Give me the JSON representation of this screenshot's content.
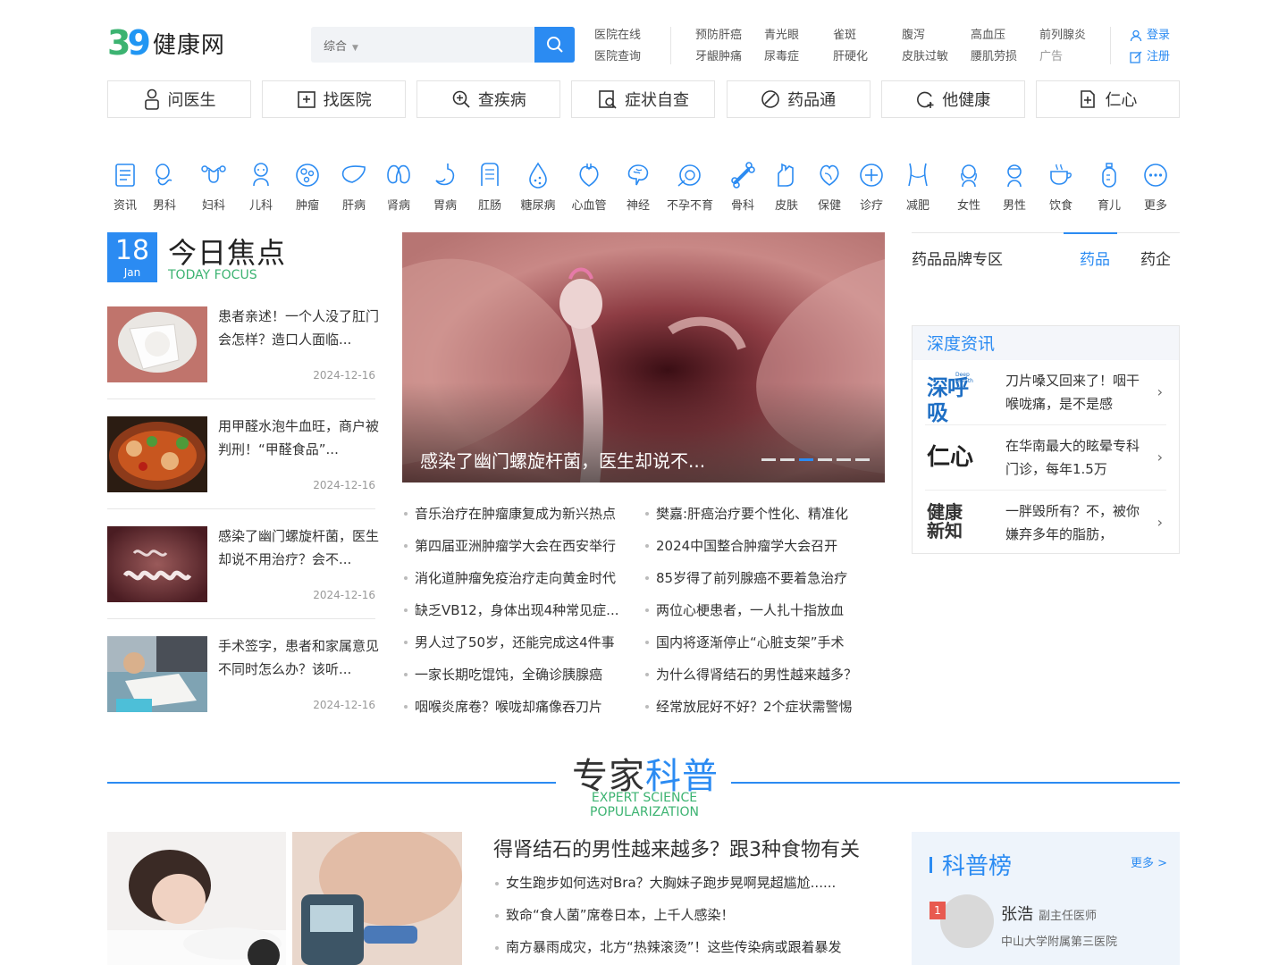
{
  "logo": {
    "digit_3": "3",
    "digit_9": "9",
    "text": "39健康网"
  },
  "search": {
    "category": "综合",
    "placeholder": ""
  },
  "toplinks": [
    [
      "医院在线",
      "医院查询"
    ],
    [
      "预防肝癌",
      "牙龈肿痛"
    ],
    [
      "青光眼",
      "尿毒症"
    ],
    [
      "雀斑",
      "肝硬化"
    ],
    [
      "腹泻",
      "皮肤过敏"
    ],
    [
      "高血压",
      "腰肌劳损"
    ],
    [
      "前列腺炎",
      "广告"
    ]
  ],
  "user": {
    "login": "登录",
    "register": "注册"
  },
  "mainnav": [
    "问医生",
    "找医院",
    "查疾病",
    "症状自查",
    "药品通",
    "他健康",
    "仁心"
  ],
  "categories": [
    "资讯",
    "男科",
    "妇科",
    "儿科",
    "肿瘤",
    "肝病",
    "肾病",
    "胃病",
    "肛肠",
    "糖尿病",
    "心血管",
    "神经",
    "不孕不育",
    "骨科",
    "皮肤",
    "保健",
    "诊疗",
    "减肥",
    "女性",
    "男性",
    "饮食",
    "育儿",
    "更多"
  ],
  "focus": {
    "day": "18",
    "month": "Jan",
    "title": "今日焦点",
    "subtitle": "TODAY FOCUS",
    "items": [
      {
        "title": "患者亲述！一个人没了肛门会怎样？造口人面临...",
        "date": "2024-12-16"
      },
      {
        "title": "用甲醛水泡牛血旺，商户被判刑！“甲醛食品”...",
        "date": "2024-12-16"
      },
      {
        "title": "感染了幽门螺旋杆菌，医生却说不用治疗？会不...",
        "date": "2024-12-16"
      },
      {
        "title": "手术签字，患者和家属意见不同时怎么办？该听...",
        "date": "2024-12-16"
      }
    ]
  },
  "carousel": {
    "caption": "感染了幽门螺旋杆菌，医生却说不...",
    "active_dot": 3,
    "dot_count": 6
  },
  "news": [
    [
      "音乐治疗在肿瘤康复成为新兴热点",
      "樊嘉:肝癌治疗要个性化、精准化"
    ],
    [
      "第四届亚洲肿瘤学大会在西安举行",
      "2024中国整合肿瘤学大会召开"
    ],
    [
      "消化道肿瘤免疫治疗走向黄金时代",
      "85岁得了前列腺癌不要着急治疗"
    ],
    [
      "缺乏VB12，身体出现4种常见症...",
      "两位心梗患者，一人扎十指放血"
    ],
    [
      "男人过了50岁，还能完成这4件事",
      "国内将逐渐停止“心脏支架”手术"
    ],
    [
      "一家长期吃馄饨，全确诊胰腺癌",
      "为什么得肾结石的男性越来越多？"
    ],
    [
      "咽喉炎席卷？喉咙却痛像吞刀片",
      "经常放屁好不好？2个症状需警惕"
    ]
  ],
  "brand": {
    "title": "药品品牌专区",
    "tab_active": "药品",
    "tab_other": "药企"
  },
  "deep": {
    "heading": "深度资讯",
    "items": [
      {
        "logo": "深呼吸",
        "logo_en": "Deep Breath",
        "title": "刀片嗓又回来了！咽干喉咙痛，是不是感"
      },
      {
        "logo": "仁心",
        "title": "在华南最大的眩晕专科门诊，每年1.5万"
      },
      {
        "logo": "健康新知",
        "title": "一胖毁所有？不，被你嫌弃多年的脂肪，"
      }
    ]
  },
  "expert": {
    "title_a": "专家",
    "title_b": "科普",
    "subtitle": "EXPERT SCIENCE POPULARIZATION",
    "headline": "得肾结石的男性越来越多？跟3种食物有关",
    "items": [
      "女生跑步如何选对Bra？大胸妹子跑步晃啊晃超尴尬......",
      "致命“食人菌”席卷日本，上千人感染！",
      "南方暴雨成灾，北方“热辣滚烫”！这些传染病或跟着暴发"
    ]
  },
  "rank": {
    "title": "科普榜",
    "more": "更多 >",
    "badge": "1",
    "name": "张浩",
    "role": "副主任医师",
    "hospital": "中山大学附属第三医院"
  },
  "colors": {
    "accent": "#2b8bf2",
    "green": "#3cb371",
    "red": "#e85a4f"
  }
}
